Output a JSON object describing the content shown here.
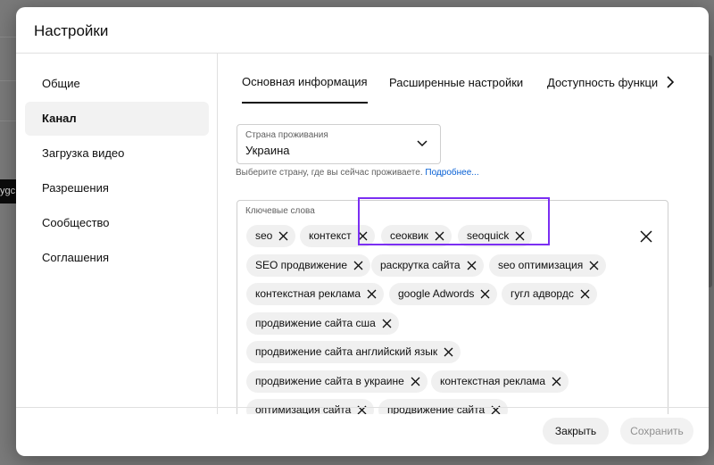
{
  "background": {
    "chip_text": "ygc"
  },
  "dialog": {
    "title": "Настройки",
    "sidebar": {
      "items": [
        {
          "label": "Общие",
          "active": false
        },
        {
          "label": "Канал",
          "active": true
        },
        {
          "label": "Загрузка видео",
          "active": false
        },
        {
          "label": "Разрешения",
          "active": false
        },
        {
          "label": "Сообщество",
          "active": false
        },
        {
          "label": "Соглашения",
          "active": false
        }
      ]
    },
    "tabs": [
      {
        "label": "Основная информация",
        "active": true
      },
      {
        "label": "Расширенные настройки",
        "active": false
      },
      {
        "label": "Доступность функций",
        "active": false
      }
    ],
    "country": {
      "label": "Страна проживания",
      "value": "Украина",
      "helper": "Выберите страну, где вы сейчас проживаете.",
      "helper_link": "Подробнее..."
    },
    "keywords": {
      "label": "Ключевые слова",
      "chips": [
        "seo",
        "контекст",
        "сеоквик",
        "seoquick",
        "SEO продвижение",
        "раскрутка сайта",
        "seo оптимизация",
        "контекстная реклама",
        "google Adwords",
        "гугл адвордс",
        "продвижение сайта сша",
        "продвижение сайта английский язык",
        "продвижение сайта в украине",
        "контекстная реклама",
        "оптимизация сайта",
        "продвижение сайта"
      ]
    },
    "footer": {
      "close_label": "Закрыть",
      "save_label": "Сохранить"
    }
  },
  "colors": {
    "highlight": "#7b2ff2",
    "link": "#065fd4",
    "chip_bg": "#f0f0f0"
  }
}
